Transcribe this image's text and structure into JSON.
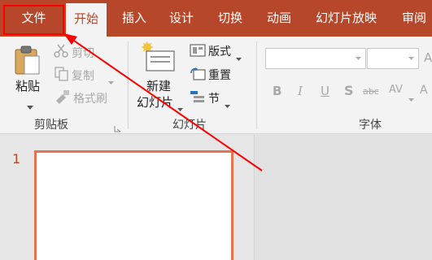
{
  "tabs": [
    {
      "label": "文件",
      "state": "highlighted"
    },
    {
      "label": "开始",
      "state": "active"
    },
    {
      "label": "插入"
    },
    {
      "label": "设计"
    },
    {
      "label": "切换"
    },
    {
      "label": "动画"
    },
    {
      "label": "幻灯片放映"
    },
    {
      "label": "审阅"
    }
  ],
  "clipboard": {
    "paste": "粘贴",
    "cut": "剪切",
    "copy": "复制",
    "format_painter": "格式刷",
    "label": "剪贴板"
  },
  "slides_group": {
    "new_line1": "新建",
    "new_line2": "幻灯片",
    "layout": "版式",
    "reset": "重置",
    "section": "节",
    "label": "幻灯片"
  },
  "font_group": {
    "bold": "B",
    "italic": "I",
    "underline": "U",
    "shadow": "S",
    "strike": "abc",
    "spacing": "AV",
    "label": "字体"
  },
  "slide_panel": {
    "number": "1"
  },
  "colors": {
    "accent": "#b7472a",
    "annotation": "#ff0000"
  }
}
